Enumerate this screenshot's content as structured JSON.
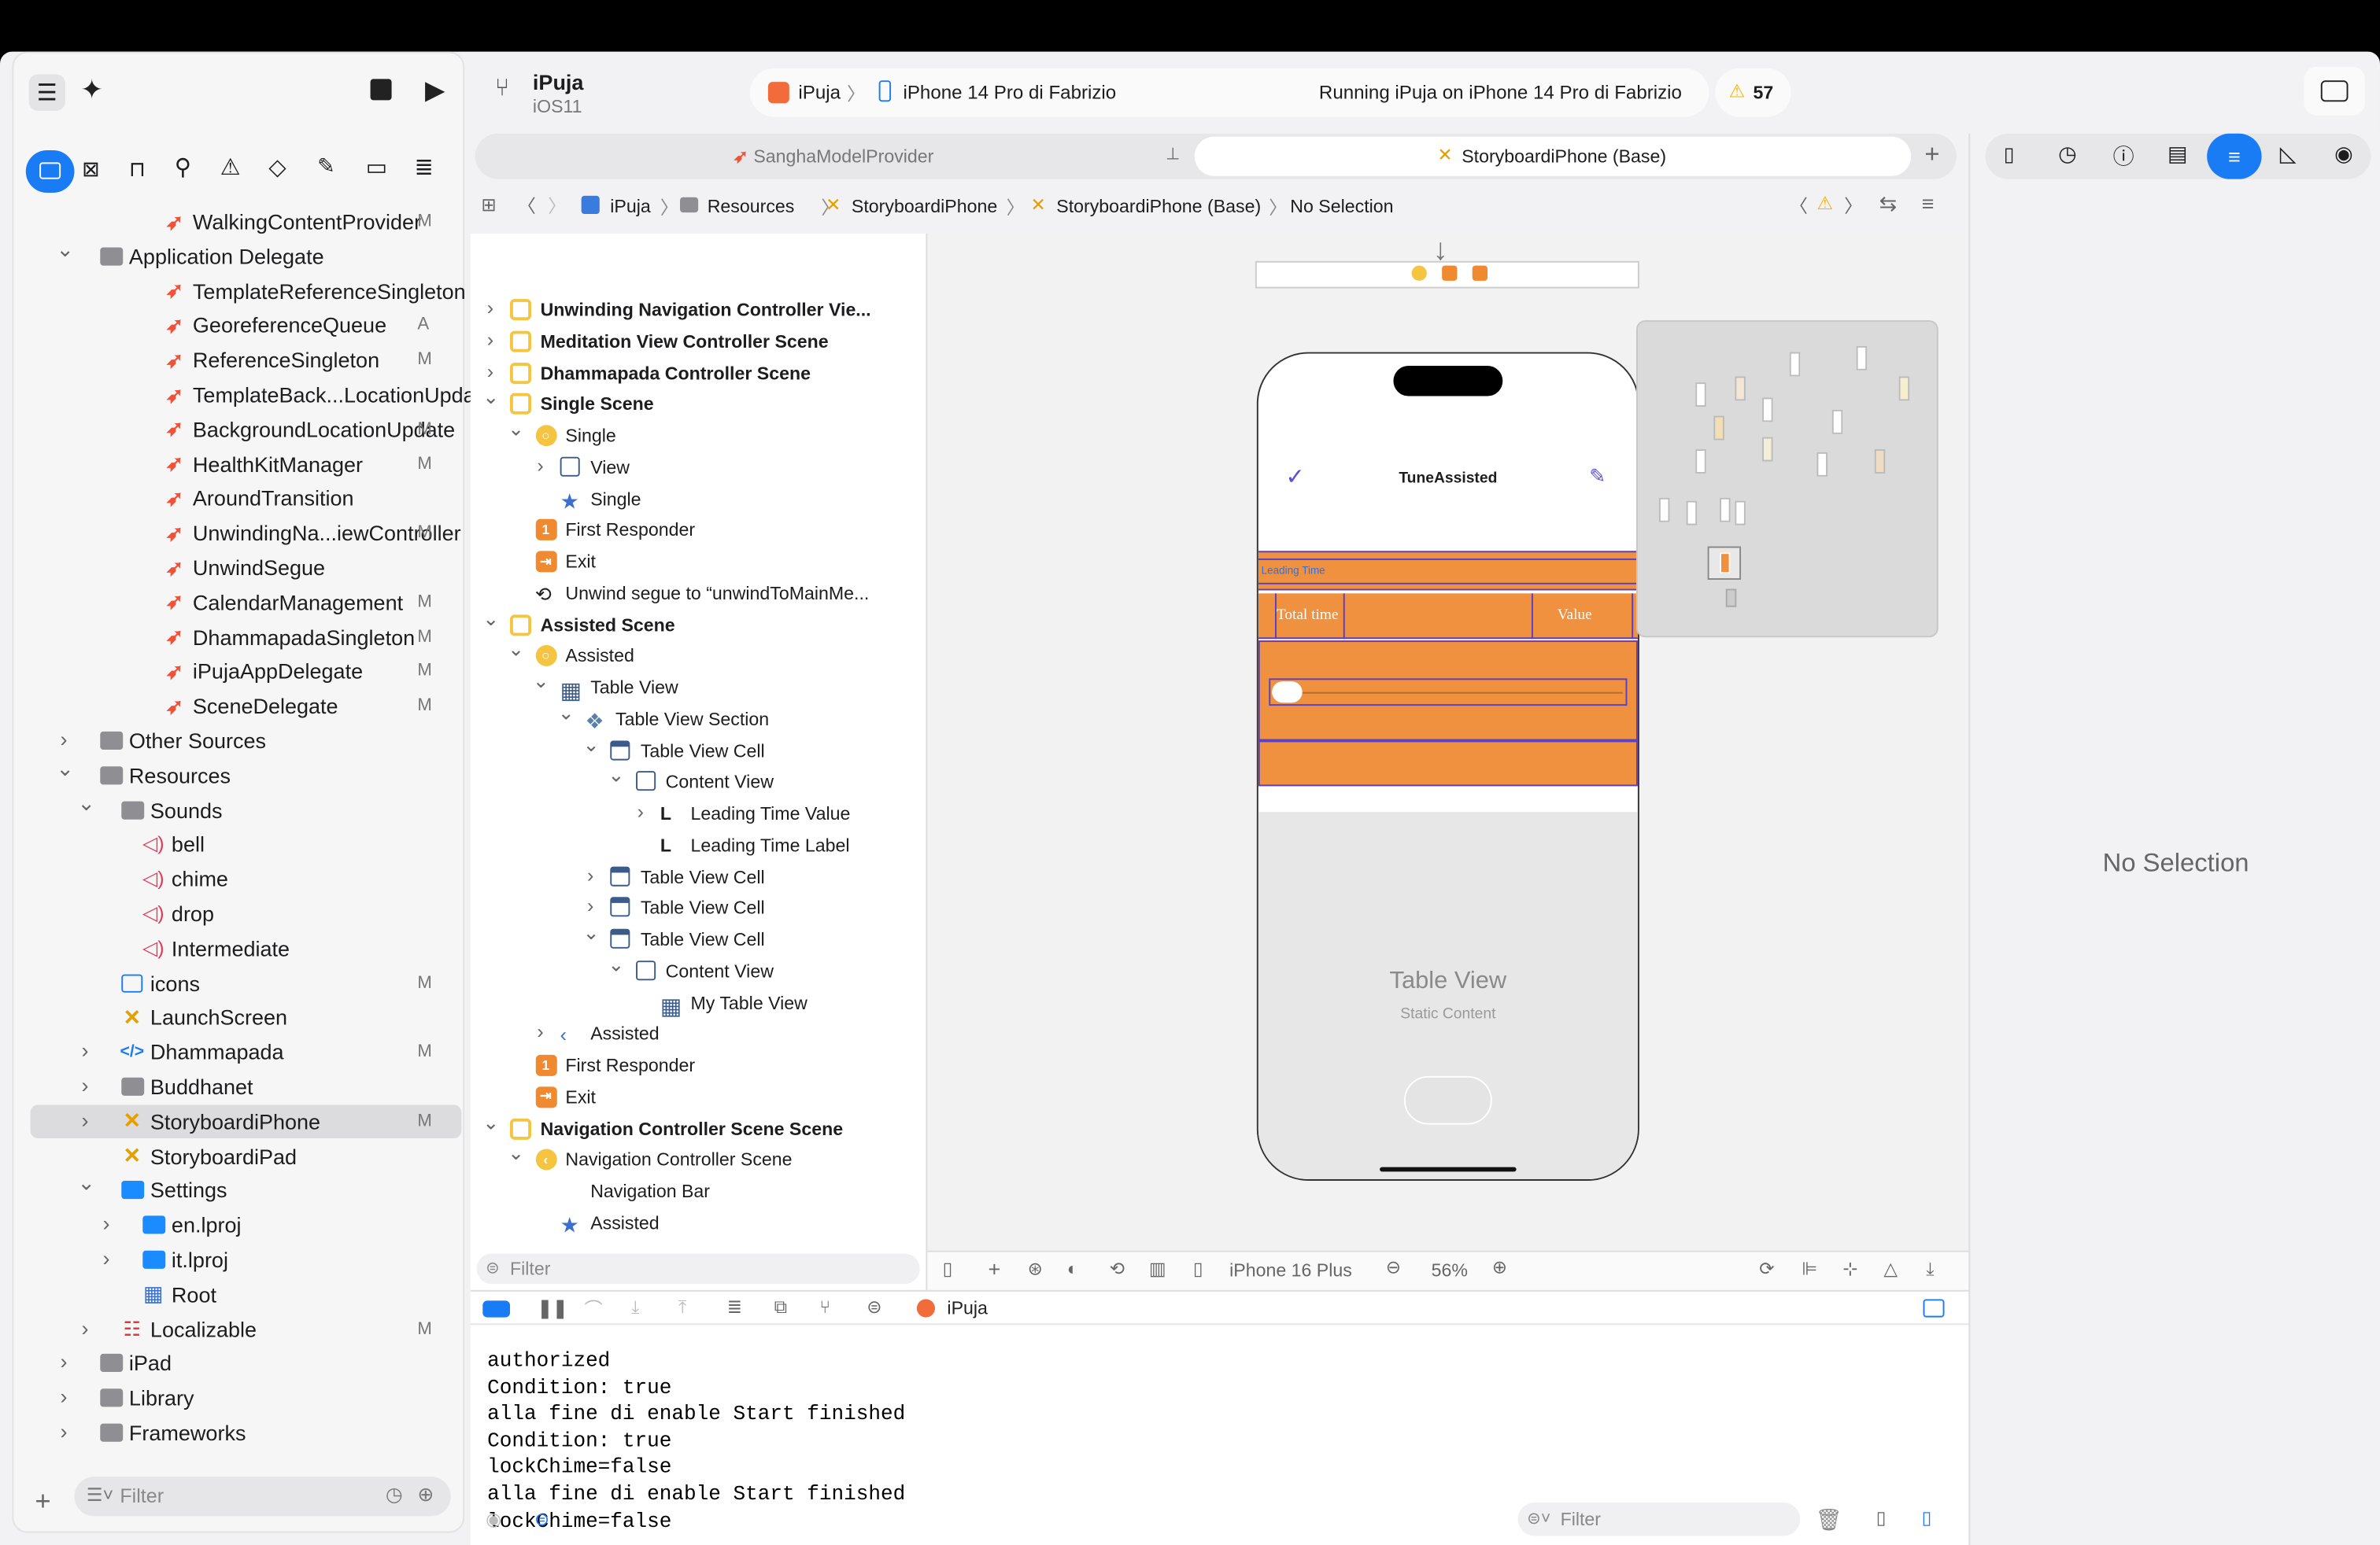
{
  "toolbar": {
    "project": "iPuja",
    "target": "iOS11",
    "scheme": "iPuja",
    "device": "iPhone 14 Pro di Fabrizio",
    "status": "Running iPuja on iPhone 14 Pro di Fabrizio",
    "warnings": "57"
  },
  "tabs": [
    {
      "label": "SanghaModelProvider"
    },
    {
      "label": "StoryboardiPhone (Base)"
    }
  ],
  "jumpbar": [
    "iPuja",
    "Resources",
    "StoryboardiPhone",
    "StoryboardiPhone (Base)",
    "No Selection"
  ],
  "navigator": {
    "items": [
      {
        "label": "WalkingContentProvider",
        "status": "M",
        "type": "swift"
      },
      {
        "label": "Application Delegate",
        "status": "",
        "type": "folder"
      },
      {
        "label": "TemplateReferenceSingleton",
        "status": "",
        "type": "swift"
      },
      {
        "label": "GeoreferenceQueue",
        "status": "A",
        "type": "swift"
      },
      {
        "label": "ReferenceSingleton",
        "status": "M",
        "type": "swift"
      },
      {
        "label": "TemplateBack...LocationUpdate",
        "status": "",
        "type": "swift"
      },
      {
        "label": "BackgroundLocationUpdate",
        "status": "M",
        "type": "swift"
      },
      {
        "label": "HealthKitManager",
        "status": "M",
        "type": "swift"
      },
      {
        "label": "AroundTransition",
        "status": "",
        "type": "swift"
      },
      {
        "label": "UnwindingNa...iewController",
        "status": "M",
        "type": "swift"
      },
      {
        "label": "UnwindSegue",
        "status": "",
        "type": "swift"
      },
      {
        "label": "CalendarManagement",
        "status": "M",
        "type": "swift"
      },
      {
        "label": "DhammapadaSingleton",
        "status": "M",
        "type": "swift"
      },
      {
        "label": "iPujaAppDelegate",
        "status": "M",
        "type": "swift"
      },
      {
        "label": "SceneDelegate",
        "status": "M",
        "type": "swift"
      },
      {
        "label": "Other Sources",
        "status": "",
        "type": "folder"
      },
      {
        "label": "Resources",
        "status": "",
        "type": "folder"
      },
      {
        "label": "Sounds",
        "status": "",
        "type": "folder"
      },
      {
        "label": "bell",
        "status": "",
        "type": "sound"
      },
      {
        "label": "chime",
        "status": "",
        "type": "sound"
      },
      {
        "label": "drop",
        "status": "",
        "type": "sound"
      },
      {
        "label": "Intermediate",
        "status": "",
        "type": "sound"
      },
      {
        "label": "icons",
        "status": "M",
        "type": "assets"
      },
      {
        "label": "LaunchScreen",
        "status": "",
        "type": "storyboard"
      },
      {
        "label": "Dhammapada",
        "status": "M",
        "type": "code"
      },
      {
        "label": "Buddhanet",
        "status": "",
        "type": "folder"
      },
      {
        "label": "StoryboardiPhone",
        "status": "M",
        "type": "storyboard"
      },
      {
        "label": "StoryboardiPad",
        "status": "",
        "type": "storyboard"
      },
      {
        "label": "Settings",
        "status": "",
        "type": "bundle"
      },
      {
        "label": "en.lproj",
        "status": "",
        "type": "bluefolder"
      },
      {
        "label": "it.lproj",
        "status": "",
        "type": "bluefolder"
      },
      {
        "label": "Root",
        "status": "",
        "type": "table"
      },
      {
        "label": "Localizable",
        "status": "M",
        "type": "strings"
      },
      {
        "label": "iPad",
        "status": "",
        "type": "folder"
      },
      {
        "label": "Library",
        "status": "",
        "type": "folder"
      },
      {
        "label": "Frameworks",
        "status": "",
        "type": "folder"
      }
    ],
    "filter_placeholder": "Filter"
  },
  "outline": {
    "items": [
      "Unwinding Navigation Controller Vie...",
      "Meditation View Controller Scene",
      "Dhammapada Controller Scene",
      "Single Scene",
      "Single",
      "View",
      "Single",
      "First Responder",
      "Exit",
      "Unwind segue to “unwindToMainMe...",
      "Assisted Scene",
      "Assisted",
      "Table View",
      "Table View Section",
      "Table View Cell",
      "Content View",
      "Leading Time Value",
      "Leading Time Label",
      "Table View Cell",
      "Table View Cell",
      "Table View Cell",
      "Content View",
      "My Table View",
      "Assisted",
      "First Responder",
      "Exit",
      "Navigation Controller Scene Scene",
      "Navigation Controller Scene",
      "Navigation Bar",
      "Assisted"
    ],
    "filter_placeholder": "Filter"
  },
  "canvas": {
    "nav_title": "TuneAssisted",
    "leading_time": "Leading Time",
    "total_time": "Total time",
    "value": "Value",
    "table_view": "Table View",
    "static_content": "Static Content",
    "device": "iPhone 16 Plus",
    "zoom": "56%"
  },
  "debug": {
    "process": "iPuja",
    "console": [
      "authorized",
      "Condition: true",
      "alla fine di enable Start finished",
      "Condition: true",
      "lockChime=false",
      "alla fine di enable Start finished",
      "lockChime=false"
    ],
    "filter_placeholder": "Filter"
  },
  "inspector": {
    "empty": "No Selection"
  },
  "colors": {
    "accent": "#1a7cf5",
    "swift": "#f05138",
    "canvas_orange": "#f0913f",
    "warning": "#f5b400"
  }
}
